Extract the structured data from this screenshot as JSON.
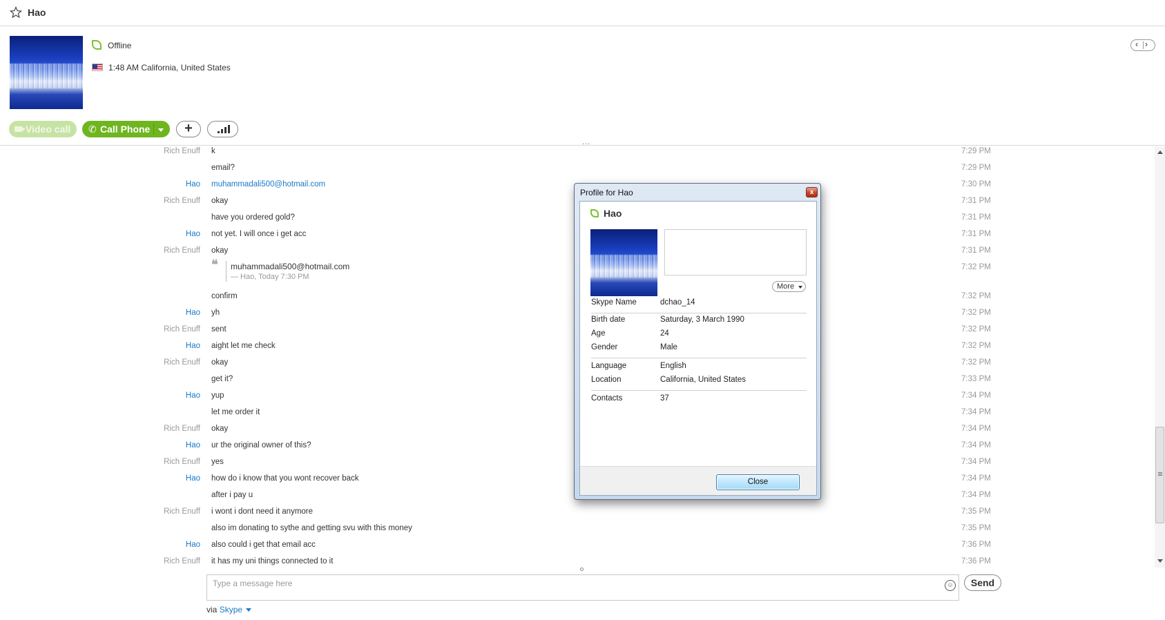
{
  "window": {
    "title": "Hao"
  },
  "header": {
    "status": "Offline",
    "local_time": "1:48 AM California, United States",
    "nav_prev": "‹",
    "nav_next": "›"
  },
  "toolbar": {
    "video_call": "Video call",
    "call_phone": "Call Phone",
    "add_label": "+"
  },
  "chat": {
    "drag_handle": "...",
    "messages": [
      {
        "sender": "Rich Enuff",
        "text": "k",
        "time": "7:29 PM"
      },
      {
        "sender": "",
        "text": "email?",
        "time": "7:29 PM"
      },
      {
        "sender": "Hao",
        "text": "muhammadali500@hotmail.com",
        "time": "7:30 PM",
        "link": true
      },
      {
        "sender": "Rich Enuff",
        "text": "okay",
        "time": "7:31 PM"
      },
      {
        "sender": "",
        "text": "have you ordered gold?",
        "time": "7:31 PM"
      },
      {
        "sender": "Hao",
        "text": "not yet. I will once i get acc",
        "time": "7:31 PM"
      },
      {
        "sender": "Rich Enuff",
        "text": "okay",
        "time": "7:31 PM"
      },
      {
        "sender": "",
        "text": "",
        "time": "7:32 PM"
      },
      {
        "sender": "",
        "text": "confirm",
        "time": "7:32 PM"
      },
      {
        "sender": "Hao",
        "text": "yh",
        "time": "7:32 PM"
      },
      {
        "sender": "Rich Enuff",
        "text": "sent",
        "time": "7:32 PM"
      },
      {
        "sender": "Hao",
        "text": "aight let me check",
        "time": "7:32 PM"
      },
      {
        "sender": "Rich Enuff",
        "text": "okay",
        "time": "7:32 PM"
      },
      {
        "sender": "",
        "text": "get it?",
        "time": "7:33 PM"
      },
      {
        "sender": "Hao",
        "text": "yup",
        "time": "7:34 PM"
      },
      {
        "sender": "",
        "text": "let me order it",
        "time": "7:34 PM"
      },
      {
        "sender": "Rich Enuff",
        "text": "okay",
        "time": "7:34 PM"
      },
      {
        "sender": "Hao",
        "text": "ur the original owner of this?",
        "time": "7:34 PM"
      },
      {
        "sender": "Rich Enuff",
        "text": "yes",
        "time": "7:34 PM"
      },
      {
        "sender": "Hao",
        "text": "how do i know that you wont recover back",
        "time": "7:34 PM"
      },
      {
        "sender": "",
        "text": "after i pay u",
        "time": "7:34 PM"
      },
      {
        "sender": "Rich Enuff",
        "text": "i wont i dont need it anymore",
        "time": "7:35 PM"
      },
      {
        "sender": "",
        "text": "also im donating to sythe and getting svu with this money",
        "time": "7:35 PM"
      },
      {
        "sender": "Hao",
        "text": "also could i get that email acc",
        "time": "7:36 PM"
      },
      {
        "sender": "Rich Enuff",
        "text": "it has my uni things connected to it",
        "time": "7:36 PM"
      }
    ],
    "quote": {
      "mark": "❝",
      "text": "muhammadali500@hotmail.com",
      "meta": "— Hao, Today 7:30 PM"
    }
  },
  "compose": {
    "placeholder": "Type a message here",
    "send_label": "Send",
    "via_label": "via",
    "via_service": "Skype"
  },
  "profile_dialog": {
    "title": "Profile for Hao",
    "name": "Hao",
    "more_label": "More",
    "fields": {
      "skype_name": {
        "label": "Skype Name",
        "value": "dchao_14"
      },
      "birth_date": {
        "label": "Birth date",
        "value": "Saturday, 3 March 1990"
      },
      "age": {
        "label": "Age",
        "value": "24"
      },
      "gender": {
        "label": "Gender",
        "value": "Male"
      },
      "language": {
        "label": "Language",
        "value": "English"
      },
      "location": {
        "label": "Location",
        "value": "California, United States"
      },
      "contacts": {
        "label": "Contacts",
        "value": "37"
      }
    },
    "close_label": "Close",
    "close_x": "x"
  },
  "colors": {
    "accent": "#1b79c8",
    "call_green": "#6fb51f",
    "status_green": "#7cc030"
  },
  "icons": [
    "star-icon",
    "status-leaf-icon",
    "us-flag-icon",
    "video-camera-icon",
    "phone-icon",
    "plus-icon",
    "signal-bars-icon",
    "emoji-icon",
    "close-icon"
  ]
}
